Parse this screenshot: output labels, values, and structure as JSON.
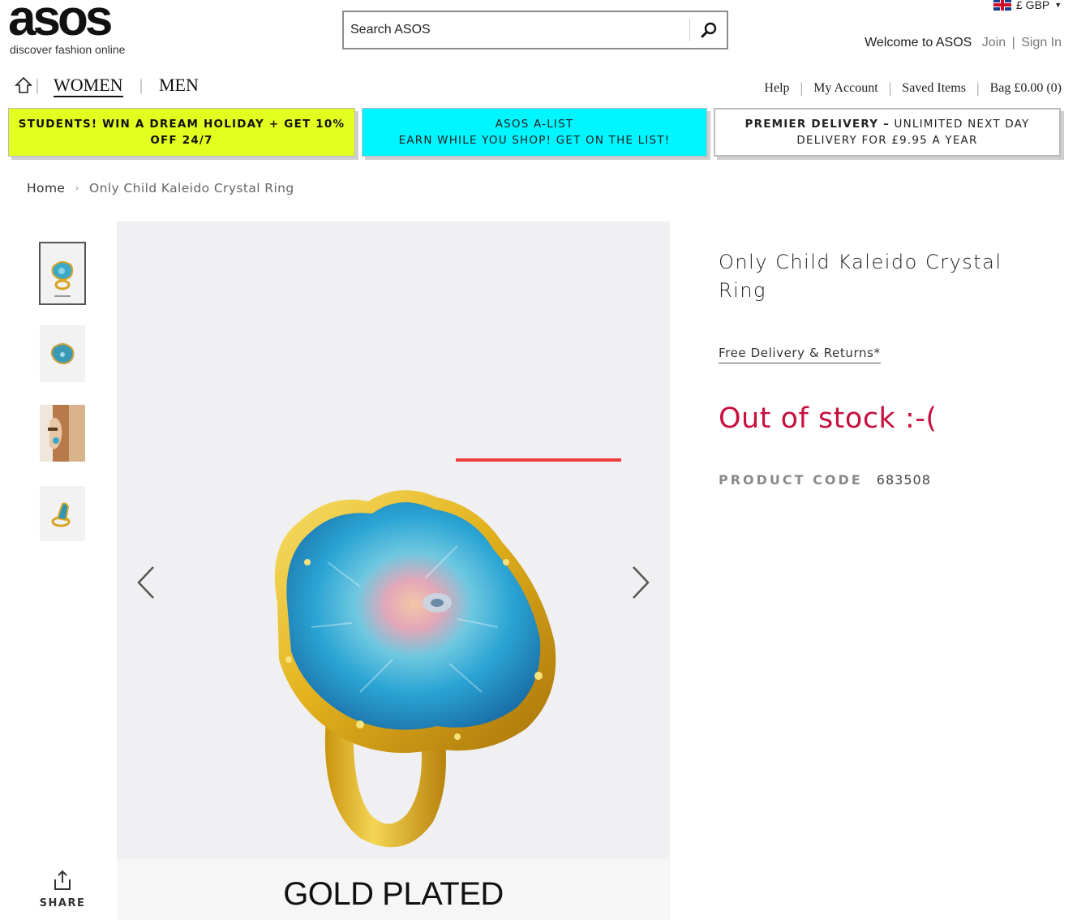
{
  "header": {
    "logo_text": "asos",
    "logo_tagline": "discover fashion online",
    "search_placeholder": "Search ASOS",
    "currency": "£ GBP",
    "welcome_text": "Welcome to ASOS",
    "join_label": "Join",
    "signin_label": "Sign In"
  },
  "nav": {
    "women_label": "WOMEN",
    "men_label": "MEN",
    "help_label": "Help",
    "account_label": "My Account",
    "saved_label": "Saved Items",
    "bag_label": "Bag £0.00 (0)"
  },
  "promos": [
    {
      "line1": "STUDENTS! WIN A DREAM HOLIDAY + GET 10%",
      "line2": "OFF 24/7",
      "color": "#e3ff1f"
    },
    {
      "line1": "ASOS A-LIST",
      "line2": "EARN WHILE YOU SHOP! GET ON THE LIST!",
      "color": "#00f6ff"
    },
    {
      "bold": "PREMIER DELIVERY –",
      "line1": " UNLIMITED NEXT DAY",
      "line2": "DELIVERY FOR £9.95 A YEAR",
      "color": "#ffffff"
    }
  ],
  "breadcrumb": {
    "home": "Home",
    "current": "Only Child Kaleido Crystal Ring"
  },
  "product": {
    "title": "Only Child Kaleido Crystal Ring",
    "delivery_link": "Free Delivery & Returns*",
    "stock_status": "Out of stock :-(",
    "code_label": "PRODUCT CODE",
    "code_value": "683508",
    "image_caption": "GOLD PLATED",
    "stock_color": "#c8103f"
  },
  "share_label": "SHARE"
}
